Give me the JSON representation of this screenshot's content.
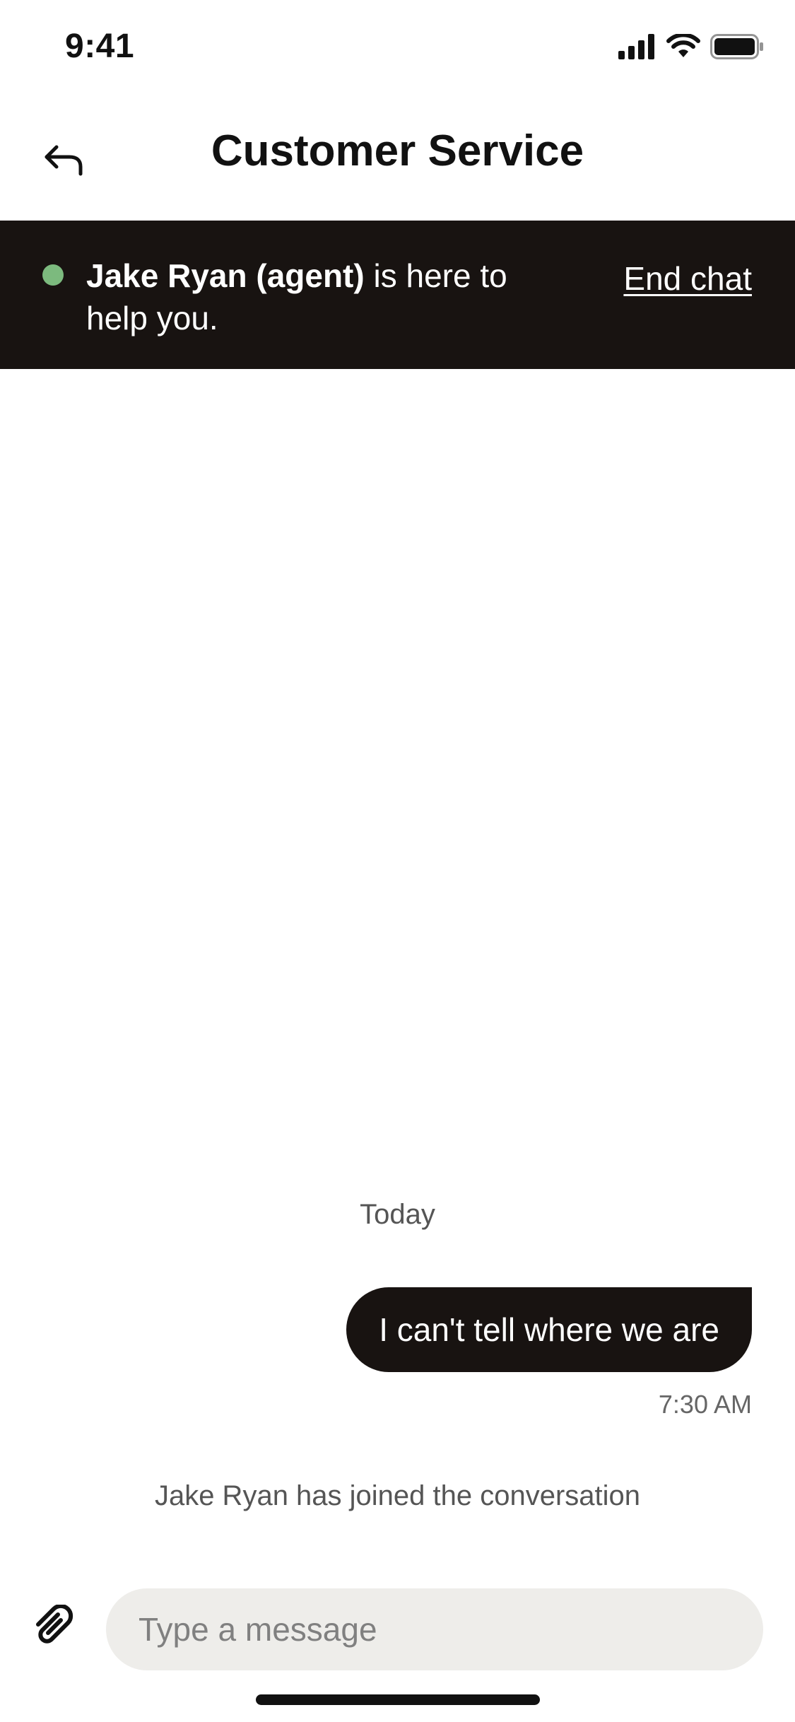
{
  "status_bar": {
    "time": "9:41",
    "icons": [
      "signal-icon",
      "wifi-icon",
      "battery-icon"
    ]
  },
  "header": {
    "title": "Customer Service",
    "back_icon": "back-arrow-icon"
  },
  "agent_banner": {
    "agent_name": "Jake Ryan (agent)",
    "message_rest": " is here to help you.",
    "end_chat_label": "End chat",
    "presence_color": "#7cba7e",
    "background_color": "#181311"
  },
  "conversation": {
    "date_label": "Today",
    "messages": [
      {
        "text": "I can't tell where we are",
        "time": "7:30 AM",
        "sender": "user"
      }
    ],
    "system_message": "Jake Ryan has joined the conversation"
  },
  "composer": {
    "placeholder": "Type a message",
    "attach_icon": "paperclip-icon"
  }
}
